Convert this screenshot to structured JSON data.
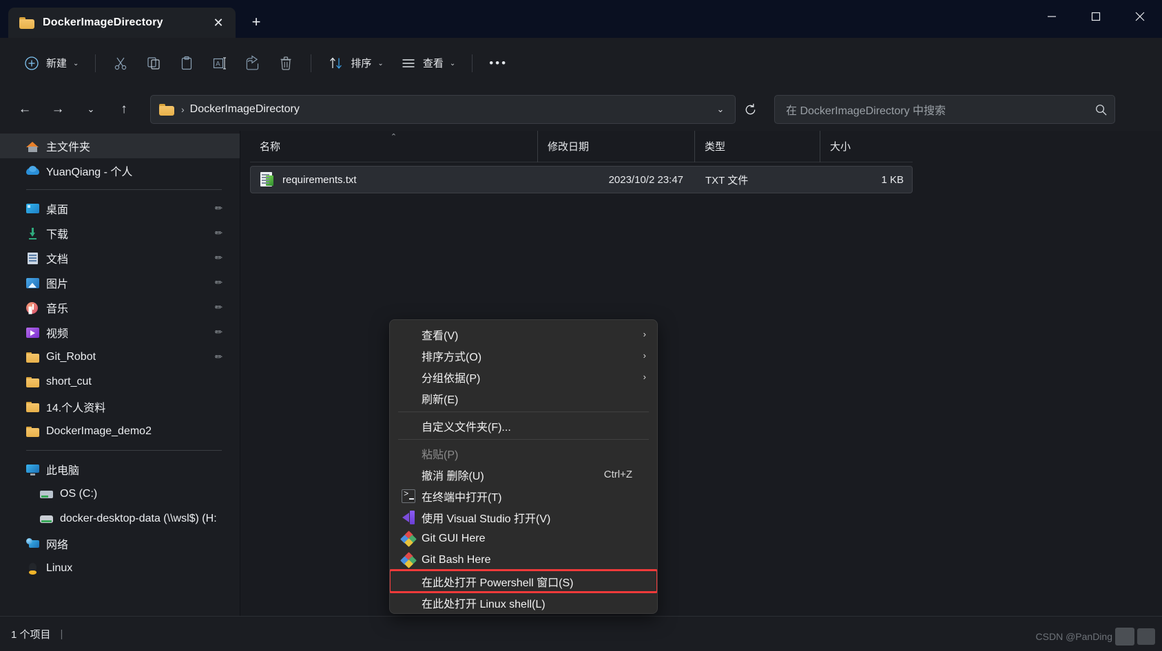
{
  "window": {
    "tab_title": "DockerImageDirectory",
    "tab_close_glyph": "✕",
    "new_tab_glyph": "+",
    "minimize_glyph": "─",
    "maximize_glyph": "☐",
    "close_glyph": "✕"
  },
  "toolbar": {
    "new_label": "新建",
    "new_chevron": "⌄",
    "cut_label": "剪切",
    "copy_label": "复制",
    "paste_label": "粘贴",
    "rename_label": "重命名",
    "share_label": "共享",
    "delete_label": "删除",
    "sort_label": "排序",
    "sort_chevron": "⌄",
    "view_label": "查看",
    "view_chevron": "⌄",
    "more_label": "•••"
  },
  "nav": {
    "back_glyph": "←",
    "forward_glyph": "→",
    "recent_glyph": "⌄",
    "up_glyph": "↑",
    "breadcrumb_root": "",
    "breadcrumb_sep": "›",
    "breadcrumb_current": "DockerImageDirectory",
    "addr_dropdown_glyph": "⌄",
    "refresh_glyph": "↻",
    "search_placeholder": "在 DockerImageDirectory 中搜索",
    "search_value": "",
    "search_icon_glyph": "⚲"
  },
  "sidebar": {
    "groups": [
      {
        "items": [
          {
            "label": "主文件夹",
            "icon": "home-icon",
            "icon_class": "ic-home",
            "selected": true,
            "pinned": false,
            "indent": 1
          },
          {
            "label": "YuanQiang - 个人",
            "icon": "onedrive-cloud-icon",
            "icon_class": "ic-cloud",
            "selected": false,
            "pinned": false,
            "indent": 1
          }
        ]
      },
      {
        "items": [
          {
            "label": "桌面",
            "icon": "desktop-icon",
            "icon_class": "ic-desktop",
            "selected": false,
            "pinned": true,
            "indent": 1
          },
          {
            "label": "下载",
            "icon": "downloads-icon",
            "icon_class": "ic-dl",
            "selected": false,
            "pinned": true,
            "indent": 1
          },
          {
            "label": "文档",
            "icon": "documents-icon",
            "icon_class": "ic-doc",
            "selected": false,
            "pinned": true,
            "indent": 1
          },
          {
            "label": "图片",
            "icon": "pictures-icon",
            "icon_class": "ic-pic",
            "selected": false,
            "pinned": true,
            "indent": 1
          },
          {
            "label": "音乐",
            "icon": "music-icon",
            "icon_class": "ic-mus",
            "selected": false,
            "pinned": true,
            "indent": 1
          },
          {
            "label": "视频",
            "icon": "videos-icon",
            "icon_class": "ic-vid",
            "selected": false,
            "pinned": true,
            "indent": 1
          },
          {
            "label": "Git_Robot",
            "icon": "folder-icon",
            "icon_class": "ic-fold",
            "selected": false,
            "pinned": true,
            "indent": 1
          },
          {
            "label": "short_cut",
            "icon": "folder-icon",
            "icon_class": "ic-fold",
            "selected": false,
            "pinned": false,
            "indent": 1
          },
          {
            "label": "14.个人资料",
            "icon": "folder-icon",
            "icon_class": "ic-fold",
            "selected": false,
            "pinned": false,
            "indent": 1
          },
          {
            "label": "DockerImage_demo2",
            "icon": "folder-icon",
            "icon_class": "ic-fold",
            "selected": false,
            "pinned": false,
            "indent": 1
          }
        ]
      },
      {
        "items": [
          {
            "label": "此电脑",
            "icon": "this-pc-icon",
            "icon_class": "ic-pc",
            "selected": false,
            "pinned": false,
            "indent": 1
          },
          {
            "label": "OS (C:)",
            "icon": "os-drive-icon",
            "icon_class": "ic-drv",
            "selected": false,
            "pinned": false,
            "indent": 2
          },
          {
            "label": "docker-desktop-data (\\\\wsl$) (H:",
            "icon": "network-drive-icon",
            "icon_class": "ic-drv2",
            "selected": false,
            "pinned": false,
            "indent": 2
          },
          {
            "label": "网络",
            "icon": "network-icon",
            "icon_class": "ic-net",
            "selected": false,
            "pinned": false,
            "indent": 1
          },
          {
            "label": "Linux",
            "icon": "linux-penguin-icon",
            "icon_class": "ic-lnx",
            "selected": false,
            "pinned": false,
            "indent": 1
          }
        ]
      }
    ]
  },
  "filelist": {
    "columns": [
      {
        "label": "名称",
        "key": "name",
        "sorted": true,
        "sort_caret": "⌃"
      },
      {
        "label": "修改日期",
        "key": "date",
        "sorted": false,
        "sort_caret": ""
      },
      {
        "label": "类型",
        "key": "type",
        "sorted": false,
        "sort_caret": ""
      },
      {
        "label": "大小",
        "key": "size",
        "sorted": false,
        "sort_caret": ""
      }
    ],
    "rows": [
      {
        "name": "requirements.txt",
        "date": "2023/10/2 23:47",
        "type": "TXT 文件",
        "size": "1 KB",
        "icon": "txt-file-icon"
      }
    ]
  },
  "statusbar": {
    "item_count": "1 个项目",
    "divider": "|",
    "watermark": "CSDN @PanDing"
  },
  "context_menu": {
    "items": [
      {
        "label": "查看(V)",
        "icon": "",
        "accel": "",
        "submenu": true,
        "disabled": false,
        "highlight": false,
        "sep_after": false
      },
      {
        "label": "排序方式(O)",
        "icon": "",
        "accel": "",
        "submenu": true,
        "disabled": false,
        "highlight": false,
        "sep_after": false
      },
      {
        "label": "分组依据(P)",
        "icon": "",
        "accel": "",
        "submenu": true,
        "disabled": false,
        "highlight": false,
        "sep_after": false
      },
      {
        "label": "刷新(E)",
        "icon": "",
        "accel": "",
        "submenu": false,
        "disabled": false,
        "highlight": false,
        "sep_after": true
      },
      {
        "label": "自定义文件夹(F)...",
        "icon": "",
        "accel": "",
        "submenu": false,
        "disabled": false,
        "highlight": false,
        "sep_after": true
      },
      {
        "label": "粘贴(P)",
        "icon": "",
        "accel": "",
        "submenu": false,
        "disabled": true,
        "highlight": false,
        "sep_after": false
      },
      {
        "label": "撤消 删除(U)",
        "icon": "",
        "accel": "Ctrl+Z",
        "submenu": false,
        "disabled": false,
        "highlight": false,
        "sep_after": false
      },
      {
        "label": "在终端中打开(T)",
        "icon": "terminal-icon",
        "accel": "",
        "submenu": false,
        "disabled": false,
        "highlight": false,
        "sep_after": false
      },
      {
        "label": "使用 Visual Studio 打开(V)",
        "icon": "visual-studio-icon",
        "accel": "",
        "submenu": false,
        "disabled": false,
        "highlight": false,
        "sep_after": false
      },
      {
        "label": "Git GUI Here",
        "icon": "git-icon",
        "accel": "",
        "submenu": false,
        "disabled": false,
        "highlight": false,
        "sep_after": false
      },
      {
        "label": "Git Bash Here",
        "icon": "git-icon",
        "accel": "",
        "submenu": false,
        "disabled": false,
        "highlight": false,
        "sep_after": false
      },
      {
        "label": "在此处打开 Powershell 窗口(S)",
        "icon": "",
        "accel": "",
        "submenu": false,
        "disabled": false,
        "highlight": true,
        "sep_after": false
      },
      {
        "label": "在此处打开 Linux shell(L)",
        "icon": "",
        "accel": "",
        "submenu": false,
        "disabled": false,
        "highlight": false,
        "sep_after": false
      }
    ],
    "submenu_arrow": "›",
    "highlight_color": "#f03a3a"
  }
}
